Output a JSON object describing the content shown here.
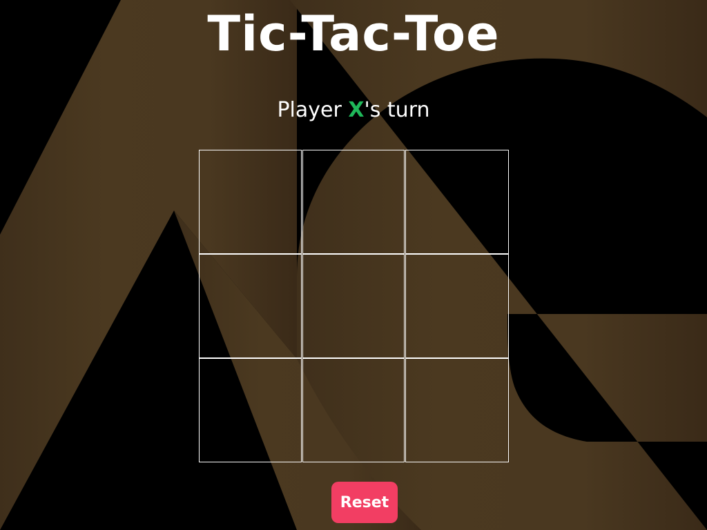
{
  "game": {
    "title": "Tic-Tac-Toe",
    "turn": {
      "prefix": "Player ",
      "mark": "X",
      "suffix": "'s turn"
    },
    "board": {
      "cells": [
        "",
        "",
        "",
        "",
        "",
        "",
        "",
        "",
        ""
      ]
    },
    "reset_label": "Reset"
  },
  "background": {
    "logo_icon": "ag-logo-icon",
    "logo_color": "#4a3820"
  },
  "colors": {
    "page_background": "#000000",
    "text": "#ffffff",
    "turn_mark": "#1fb85a",
    "reset_button": "#f23e63",
    "grid_lines": "#ffffff"
  }
}
